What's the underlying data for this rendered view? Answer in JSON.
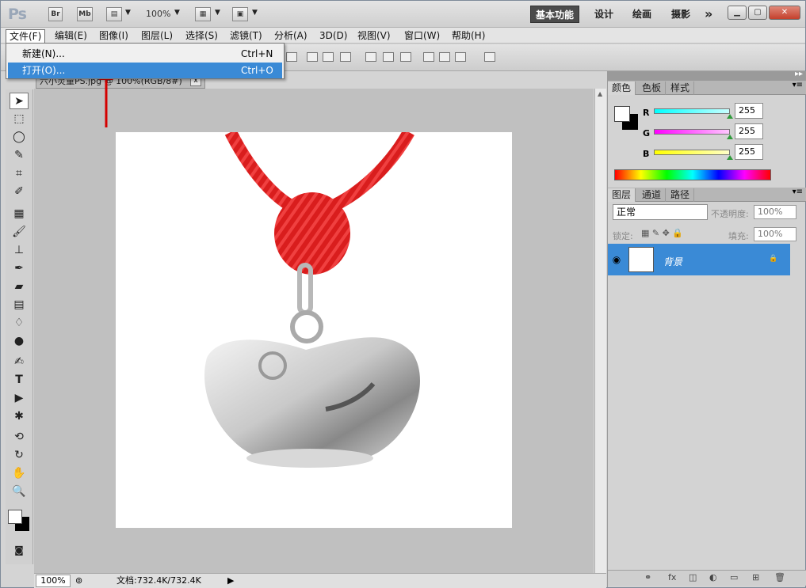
{
  "titlebar": {
    "logo": "Ps",
    "bridge": "Br",
    "minibridge": "Mb",
    "zoom": "100%",
    "workspaces": [
      "基本功能",
      "设计",
      "绘画",
      "摄影"
    ],
    "more": "»",
    "window_controls": [
      "minimize-icon",
      "restore-icon",
      "close-icon"
    ]
  },
  "menubar": {
    "items": [
      "文件(F)",
      "编辑(E)",
      "图像(I)",
      "图层(L)",
      "选择(S)",
      "滤镜(T)",
      "分析(A)",
      "3D(D)",
      "视图(V)",
      "窗口(W)",
      "帮助(H)"
    ]
  },
  "dropdown": {
    "items": [
      {
        "label": "新建(N)...",
        "shortcut": "Ctrl+N"
      },
      {
        "label": "打开(O)...",
        "shortcut": "Ctrl+O"
      }
    ]
  },
  "document": {
    "tab_title": "六小灵童PS.jpg @ 100%(RGB/8#)",
    "close": "x"
  },
  "statusbar": {
    "zoom": "100%",
    "doc_size": "文档:732.4K/732.4K"
  },
  "color_panel": {
    "tabs": [
      "颜色",
      "色板",
      "样式"
    ],
    "channels": [
      {
        "name": "R",
        "value": "255",
        "gradient": [
          "#ffffff",
          "#00ffff"
        ]
      },
      {
        "name": "G",
        "value": "255",
        "gradient": [
          "#ffffff",
          "#ff00ff"
        ]
      },
      {
        "name": "B",
        "value": "255",
        "gradient": [
          "#ffffff",
          "#ffff00"
        ]
      }
    ]
  },
  "layers_panel": {
    "tabs": [
      "图层",
      "通道",
      "路径"
    ],
    "blend_mode": "正常",
    "opacity_label": "不透明度:",
    "opacity": "100%",
    "lock_label": "锁定:",
    "fill_label": "填充:",
    "fill": "100%",
    "layers": [
      {
        "name": "背景"
      }
    ]
  },
  "colors": {
    "accent": "#3a8ad6",
    "annotation_arrow": "#d40000"
  }
}
